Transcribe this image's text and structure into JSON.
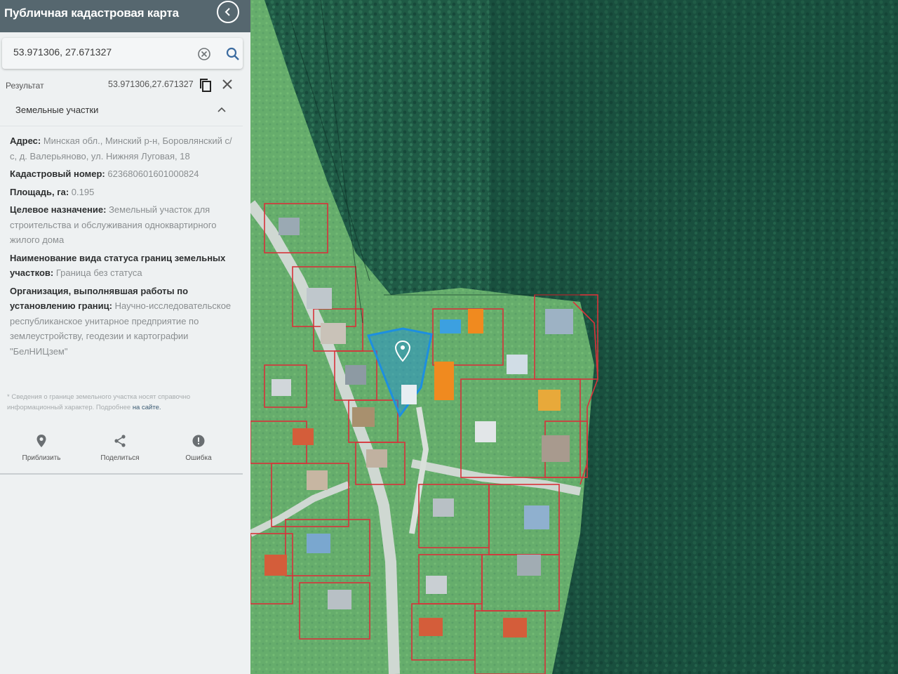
{
  "app": {
    "title": "Публичная кадастровая карта"
  },
  "search": {
    "value": "53.971306, 27.671327"
  },
  "result": {
    "label": "Результат",
    "value": "53.971306,27.671327"
  },
  "section": {
    "title": "Земельные участки"
  },
  "parcel": {
    "address_label": "Адрес:",
    "address_value": "Минская обл., Минский р-н, Боровлянский с/с, д. Валерьяново, ул. Нижняя Луговая, 18",
    "cadastral_label": "Кадастровый номер:",
    "cadastral_value": "623680601601000824",
    "area_label": "Площадь, га:",
    "area_value": "0.195",
    "purpose_label": "Целевое назначение:",
    "purpose_value": "Земельный участок для строительства и обслуживания одноквартирного жилого дома",
    "boundary_label": "Наименование вида статуса границ земельных участков:",
    "boundary_value": "Граница без статуса",
    "org_label": "Организация, выполнявшая работы по установлению границ:",
    "org_value": "Научно-исследовательское республиканское унитарное предприятие по землеустройству, геодезии и картографии \"БелНИЦзем\""
  },
  "note": {
    "text": "* Сведения о границе земельного участка носят справочно информационный характер. Подробнее",
    "link": "на сайте."
  },
  "actions": {
    "zoom": "Приблизить",
    "share": "Поделиться",
    "error": "Ошибка"
  },
  "map": {
    "selected_parcel_color": "#1d8fe0",
    "parcel_border_color": "#d8323a",
    "forest_color": "#1f5a45"
  }
}
